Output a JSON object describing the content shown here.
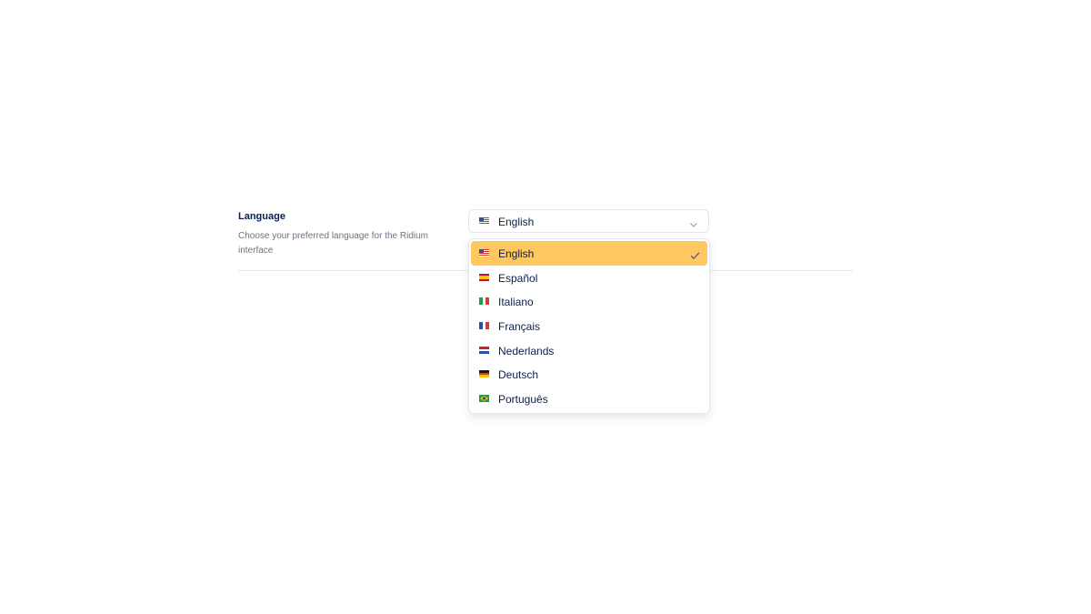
{
  "setting": {
    "title": "Language",
    "description": "Choose your preferred language for the Ridium interface"
  },
  "select": {
    "current_value": "English",
    "current_flag": "us-flag-icon",
    "chevron_icon": "chevron-down-icon"
  },
  "options": [
    {
      "label": "English",
      "flag": "us-flag-icon",
      "selected": true
    },
    {
      "label": "Español",
      "flag": "es-flag-icon",
      "selected": false
    },
    {
      "label": "Italiano",
      "flag": "it-flag-icon",
      "selected": false
    },
    {
      "label": "Français",
      "flag": "fr-flag-icon",
      "selected": false
    },
    {
      "label": "Nederlands",
      "flag": "nl-flag-icon",
      "selected": false
    },
    {
      "label": "Deutsch",
      "flag": "de-flag-icon",
      "selected": false
    },
    {
      "label": "Português",
      "flag": "br-flag-icon",
      "selected": false
    }
  ],
  "colors": {
    "selected_bg": "#fec760",
    "text": "#0b1f4d",
    "muted": "#6b7280",
    "border": "#e5e7eb"
  }
}
